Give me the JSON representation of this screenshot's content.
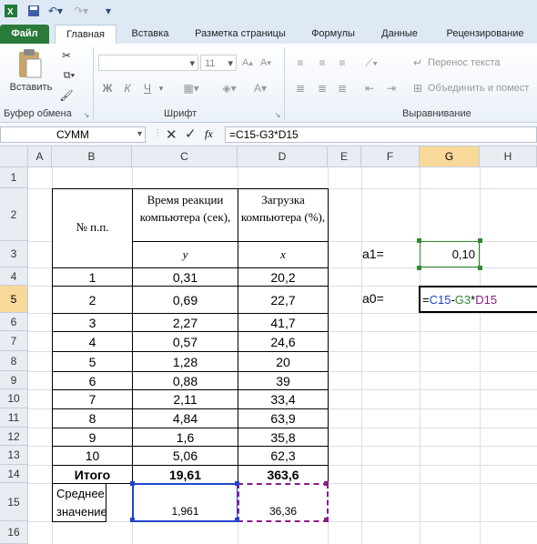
{
  "toolbar": {
    "undo_icon": "undo-icon",
    "redo_icon": "redo-icon"
  },
  "tabs": [
    "Файл",
    "Главная",
    "Вставка",
    "Разметка страницы",
    "Формулы",
    "Данные",
    "Рецензирование"
  ],
  "ribbon": {
    "paste_label": "Вставить",
    "clipboard_group": "Буфер обмена",
    "font_group": "Шрифт",
    "font_size": "11",
    "bold": "Ж",
    "italic": "К",
    "underline": "Ч",
    "wrap_text": "Перенос текста",
    "merge_center": "Объединить и помест",
    "alignment_group": "Выравнивание"
  },
  "formula_bar": {
    "name_box": "СУММ",
    "fx": "fx",
    "formula": "=C15-G3*D15"
  },
  "columns": [
    "A",
    "B",
    "C",
    "D",
    "E",
    "F",
    "G",
    "H"
  ],
  "rows": [
    "1",
    "2",
    "3",
    "4",
    "5",
    "6",
    "7",
    "8",
    "9",
    "10",
    "11",
    "12",
    "13",
    "14",
    "15",
    "16"
  ],
  "table": {
    "header_num": "№ п.п.",
    "header_c": "Время реакции компьютера (сек),",
    "header_d": "Загрузка компьютера (%),",
    "var_y": "y",
    "var_x": "x",
    "data": [
      {
        "n": "1",
        "y": "0,31",
        "x": "20,2"
      },
      {
        "n": "2",
        "y": "0,69",
        "x": "22,7"
      },
      {
        "n": "3",
        "y": "2,27",
        "x": "41,7"
      },
      {
        "n": "4",
        "y": "0,57",
        "x": "24,6"
      },
      {
        "n": "5",
        "y": "1,28",
        "x": "20"
      },
      {
        "n": "6",
        "y": "0,88",
        "x": "39"
      },
      {
        "n": "7",
        "y": "2,11",
        "x": "33,4"
      },
      {
        "n": "8",
        "y": "4,84",
        "x": "63,9"
      },
      {
        "n": "9",
        "y": "1,6",
        "x": "35,8"
      },
      {
        "n": "10",
        "y": "5,06",
        "x": "62,3"
      }
    ],
    "total_label": "Итого",
    "total_y": "19,61",
    "total_x": "363,6",
    "mean_label": "Среднее значение",
    "mean_y": "1,961",
    "mean_x": "36,36"
  },
  "params": {
    "a1_label": "а1=",
    "a1_value": "0,10",
    "a0_label": "а0=",
    "a0_formula_parts": [
      "=",
      "C15",
      "-",
      "G3",
      "*",
      "D15"
    ]
  },
  "colors": {
    "ref_c15": "#2244cc",
    "ref_g3": "#2e8b2e",
    "ref_d15": "#8b1a8b",
    "active_header": "#f9d99a",
    "file_tab": "#2a7a3a"
  }
}
